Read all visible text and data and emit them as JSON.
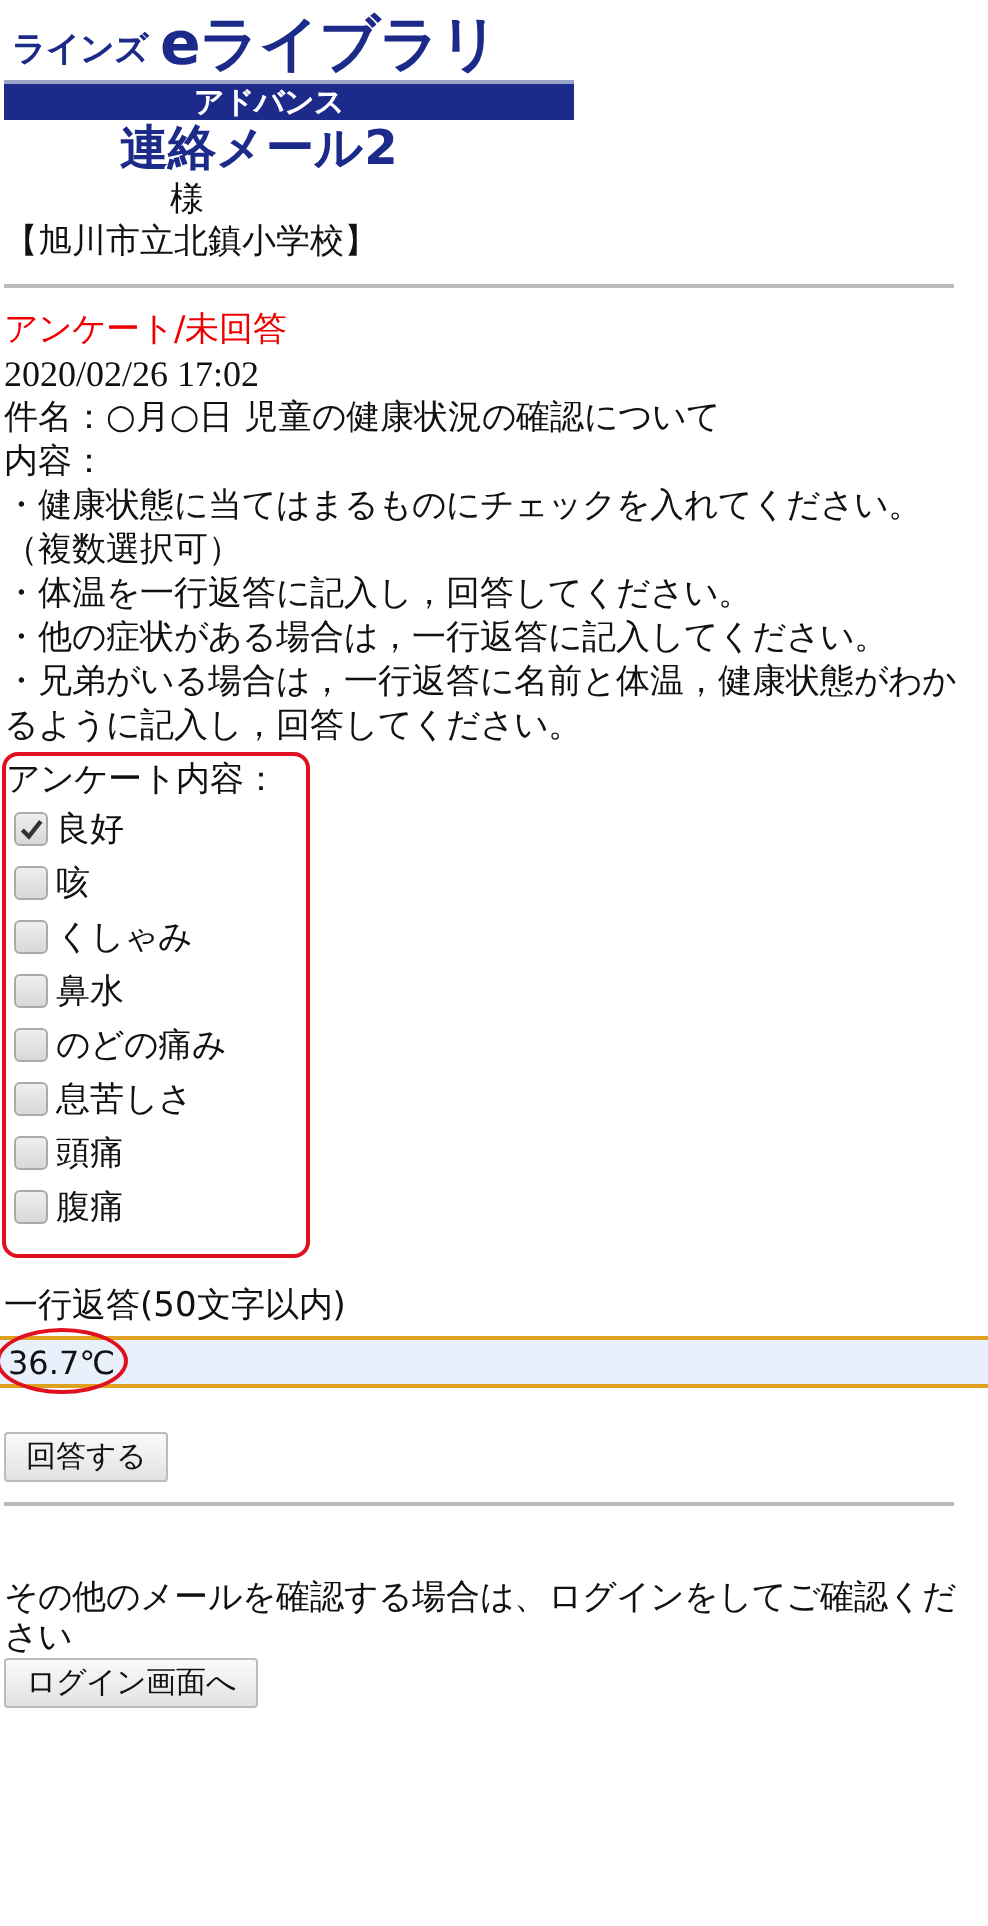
{
  "logo": {
    "brand": "ラインズ",
    "product": "eライブラリ",
    "subtitle": "アドバンス",
    "service": "連絡メール2"
  },
  "recipient": {
    "honorific": "様",
    "school": "【旭川市立北鎮小学校】"
  },
  "message": {
    "status": "アンケート/未回答",
    "datetime": "2020/02/26 17:02",
    "subject": "件名：○月○日 児童の健康状況の確認について",
    "body_label": "内容：",
    "body_lines": [
      "・健康状態に当てはまるものにチェックを入れてください。（複数選択可）",
      "・体温を一行返答に記入し，回答してください。",
      "・他の症状がある場合は，一行返答に記入してください。",
      "・兄弟がいる場合は，一行返答に名前と体温，健康状態がわかるように記入し，回答してください。"
    ]
  },
  "survey": {
    "label": "アンケート内容：",
    "highlighted": true,
    "options": [
      {
        "label": "良好",
        "checked": true
      },
      {
        "label": "咳",
        "checked": false
      },
      {
        "label": "くしゃみ",
        "checked": false
      },
      {
        "label": "鼻水",
        "checked": false
      },
      {
        "label": "のどの痛み",
        "checked": false
      },
      {
        "label": "息苦しさ",
        "checked": false
      },
      {
        "label": "頭痛",
        "checked": false
      },
      {
        "label": "腹痛",
        "checked": false
      }
    ]
  },
  "reply": {
    "label": "一行返答(50文字以内)",
    "value": "36.7℃",
    "highlighted": true
  },
  "submit_button": "回答する",
  "footer": {
    "text": "その他のメールを確認する場合は、ログインをしてご確認ください",
    "login_button": "ログイン画面へ"
  }
}
